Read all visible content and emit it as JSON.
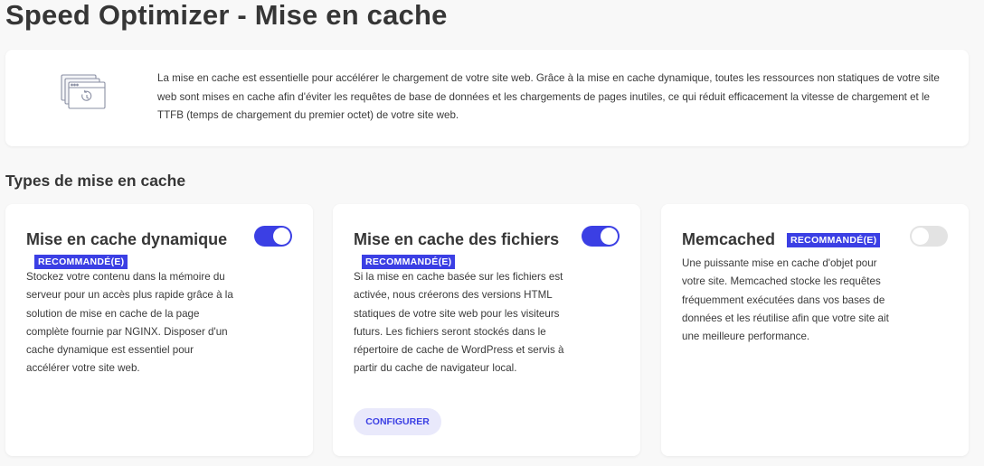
{
  "page": {
    "title": "Speed Optimizer - Mise en cache"
  },
  "intro": {
    "icon": "browser-cache-icon",
    "text": "La mise en cache est essentielle pour accélérer le chargement de votre site web. Grâce à la mise en cache dynamique, toutes les ressources non statiques de votre site web sont mises en cache afin d'éviter les requêtes de base de données et les chargements de pages inutiles, ce qui réduit efficacement la vitesse de chargement et le TTFB (temps de chargement du premier octet) de votre site web."
  },
  "section": {
    "title": "Types de mise en cache"
  },
  "cards": [
    {
      "title": "Mise en cache dynamique",
      "badge": "RECOMMANDÉ(E)",
      "enabled": true,
      "description": "Stockez votre contenu dans la mémoire du serveur pour un accès plus rapide grâce à la solution de mise en cache de la page complète fournie par NGINX. Disposer d'un cache dynamique est essentiel pour accélérer votre site web."
    },
    {
      "title": "Mise en cache des fichiers",
      "badge": "RECOMMANDÉ(E)",
      "enabled": true,
      "description": "Si la mise en cache basée sur les fichiers est activée, nous créerons des versions HTML statiques de votre site web pour les visiteurs futurs. Les fichiers seront stockés dans le répertoire de cache de WordPress et servis à partir du cache de navigateur local.",
      "button_label": "CONFIGURER"
    },
    {
      "title": "Memcached",
      "badge": "RECOMMANDÉ(E)",
      "enabled": false,
      "description": "Une puissante mise en cache d'objet pour votre site. Memcached stocke les requêtes fréquemment exécutées dans vos bases de données et les réutilise afin que votre site ait une meilleure performance."
    }
  ],
  "colors": {
    "accent": "#3b3fe4",
    "toggle_off": "#e3e3e3",
    "button_bg": "#e9e9fb",
    "page_bg": "#f8f8f8"
  }
}
